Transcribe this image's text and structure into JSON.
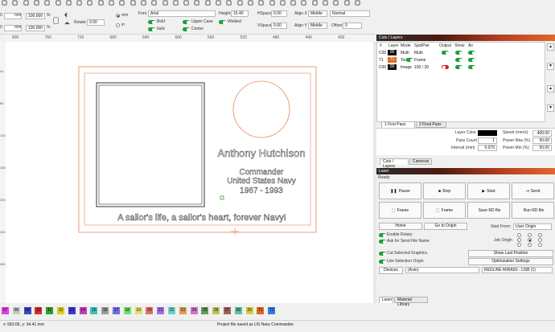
{
  "toolbar": {
    "icons": [
      "pointer-icon",
      "text-icon",
      "node-icon",
      "hand-icon",
      "rect-icon",
      "ellipse-icon",
      "polygon-icon",
      "line-icon",
      "cut-icon",
      "zoom-in-icon",
      "zoom-out-icon",
      "zoom-fit-icon",
      "camera-icon",
      "grid-icon",
      "align-icon",
      "distribute-icon",
      "flip-icon",
      "mirror-icon",
      "rotate-icon",
      "weld-icon",
      "boolean-icon",
      "offset-icon",
      "array-icon",
      "trace-icon",
      "settings-icon",
      "wrench-icon",
      "lightning-icon",
      "target-icon",
      "frame-icon",
      "crop-icon",
      "magic-icon",
      "stack-icon",
      "layers-icon",
      "warn-icon"
    ],
    "right_icons": [
      "gear-icon",
      "laser-icon",
      "camera-icon",
      "arrows-icon",
      "square-icon",
      "circle-icon",
      "dot-icon"
    ]
  },
  "editbar": {
    "x_value": "",
    "y_value": "0",
    "w_value": "100.000",
    "h_value": "100.000",
    "unit_mm": "mm",
    "pct": "%",
    "rotate_label": "Rotate",
    "rotate_value": "0.00",
    "unit_mm_radio": "mm",
    "unit_in_radio": "in",
    "font_label": "Font",
    "font_value": "Arial",
    "bold_label": "Bold",
    "italic_label": "Italic",
    "upper_label": "Upper Case",
    "welded_label": "Welded",
    "center_label": "Center",
    "height_label": "Height",
    "height_value": "15.40",
    "hspace_label": "HSpace",
    "hspace_value": "0.00",
    "vspace_label": "VSpace",
    "vspace_value": "0.00",
    "alignx_label": "Align X",
    "alignx_value": "Middle",
    "aligny_label": "Align Y",
    "aligny_value": "Middle",
    "normal_value": "Normal",
    "offset_label": "Offset",
    "offset_value": "0"
  },
  "ruler": {
    "h_ticks": [
      "800",
      "760",
      "720",
      "680",
      "640",
      "600",
      "560",
      "520",
      "480",
      "440",
      "400"
    ],
    "v_ticks": [
      "40",
      "80",
      "120",
      "160",
      "200",
      "240",
      "280"
    ]
  },
  "canvas": {
    "name_text": "Anthony Hutchison",
    "rank_text": "Commander",
    "branch_text": "United States Navy",
    "years_text": "1967 - 1993",
    "motto_text": "A sailor's life, a sailor's heart, forever Navy!"
  },
  "palette": {
    "chips": [
      {
        "label": "07",
        "color": "#e040e0"
      },
      {
        "label": "08",
        "color": "#c8c8c8"
      },
      {
        "label": "09",
        "color": "#3a4cc0"
      },
      {
        "label": "10",
        "color": "#d03030"
      },
      {
        "label": "11",
        "color": "#2fa02f"
      },
      {
        "label": "12",
        "color": "#d8d020"
      },
      {
        "label": "13",
        "color": "#3a3ad0"
      },
      {
        "label": "14",
        "color": "#c040c0"
      },
      {
        "label": "15",
        "color": "#40c0c0"
      },
      {
        "label": "16",
        "color": "#9a9a9a"
      },
      {
        "label": "17",
        "color": "#7070e0"
      },
      {
        "label": "18",
        "color": "#70e070"
      },
      {
        "label": "19",
        "color": "#e0e070"
      },
      {
        "label": "20",
        "color": "#e07070"
      },
      {
        "label": "21",
        "color": "#a070e0"
      },
      {
        "label": "22",
        "color": "#70d0d0"
      },
      {
        "label": "23",
        "color": "#e0a050"
      },
      {
        "label": "24",
        "color": "#d070d0"
      },
      {
        "label": "25",
        "color": "#60a060"
      },
      {
        "label": "26",
        "color": "#c0c060"
      },
      {
        "label": "27",
        "color": "#a06060"
      },
      {
        "label": "28",
        "color": "#60c0a0"
      },
      {
        "label": "29",
        "color": "#d0d040"
      },
      {
        "label": "T1",
        "color": "#e06a24"
      },
      {
        "label": "T2",
        "color": "#3a7ae0"
      }
    ]
  },
  "status": {
    "coords": "x: 583.66, y: 34.41 mm",
    "message": "Project file saved as US Navy Commander."
  },
  "cuts": {
    "panel_title": "Cuts / Layers",
    "headers": [
      "#",
      "Layer",
      "Mode",
      "Spd/Pwr",
      "Output",
      "Show",
      "Air"
    ],
    "rows": [
      {
        "num": "C00",
        "layer": "00",
        "color": "#111111",
        "mode": "Multi",
        "spd": "Multi",
        "output": "on",
        "show": "on",
        "air": "on"
      },
      {
        "num": "T1",
        "layer": "T1",
        "color": "#e06a24",
        "mode": "Tool",
        "spd": "Frame",
        "output": "",
        "show": "on",
        "air": "on"
      },
      {
        "num": "C00",
        "layer": "00",
        "color": "#111111",
        "mode": "Image",
        "spd": "100 / 20",
        "output": "off",
        "show": "on",
        "air": "on"
      }
    ],
    "pass_tabs": [
      "1 First Pass",
      "2 Final Pass"
    ],
    "layer_color_label": "Layer Color",
    "pass_count_label": "Pass Count",
    "pass_count_value": "1",
    "interval_label": "Interval (mm)",
    "interval_value": "0.070",
    "speed_label": "Speed (mm/s)",
    "speed_value": "400.00",
    "power_max_label": "Power Max (%)",
    "power_max_value": "50.00",
    "power_min_label": "Power Min (%)",
    "power_min_value": "50.00",
    "bottom_tabs": [
      "Cuts / Layers",
      "Cameras"
    ]
  },
  "laser": {
    "panel_title": "Laser",
    "ready": "Ready",
    "buttons": [
      "Pause",
      "Stop",
      "Start",
      "Send",
      "Frame",
      "Frame",
      "Save RD file",
      "Run RD file"
    ],
    "home": "Home",
    "goto_origin": "Go to Origin",
    "start_from_label": "Start From:",
    "start_from_value": "User Origin",
    "enable_rotary": "Enable Rotary",
    "ask_send": "Ask for Send File Name",
    "job_origin_label": "Job Origin",
    "cut_selected": "Cut Selected Graphics",
    "use_selection": "Use Selection Origin",
    "show_last": "Show Last Position",
    "optimization": "Optimization Settings",
    "devices_label": "Devices",
    "devices_value": "(Auto)",
    "device_name": "REDLINE MIRA9S - USB (1)",
    "bottom_tabs": [
      "Laser",
      "Material Library"
    ]
  }
}
